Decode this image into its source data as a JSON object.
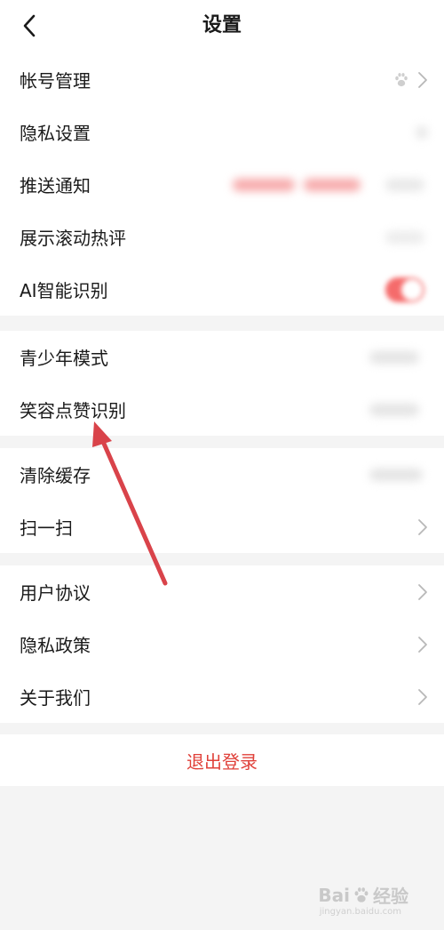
{
  "header": {
    "title": "设置"
  },
  "section1": [
    {
      "label": "帐号管理"
    },
    {
      "label": "隐私设置"
    },
    {
      "label": "推送通知"
    },
    {
      "label": "展示滚动热评"
    },
    {
      "label": "AI智能识别"
    }
  ],
  "section2": [
    {
      "label": "青少年模式"
    },
    {
      "label": "笑容点赞识别"
    }
  ],
  "section3": [
    {
      "label": "清除缓存"
    },
    {
      "label": "扫一扫"
    }
  ],
  "section4": [
    {
      "label": "用户协议"
    },
    {
      "label": "隐私政策"
    },
    {
      "label": "关于我们"
    }
  ],
  "logout": {
    "label": "退出登录"
  },
  "watermark": {
    "brand_left": "Bai",
    "brand_right": "经验",
    "site": "jingyan.baidu.com"
  },
  "colors": {
    "accent": "#e0413a",
    "toggle": "#f56b6b",
    "annotation_arrow": "#d9434a"
  },
  "icons": {
    "back": "chevron-left-icon",
    "row_arrow": "chevron-right-icon",
    "account": "paw-icon"
  }
}
